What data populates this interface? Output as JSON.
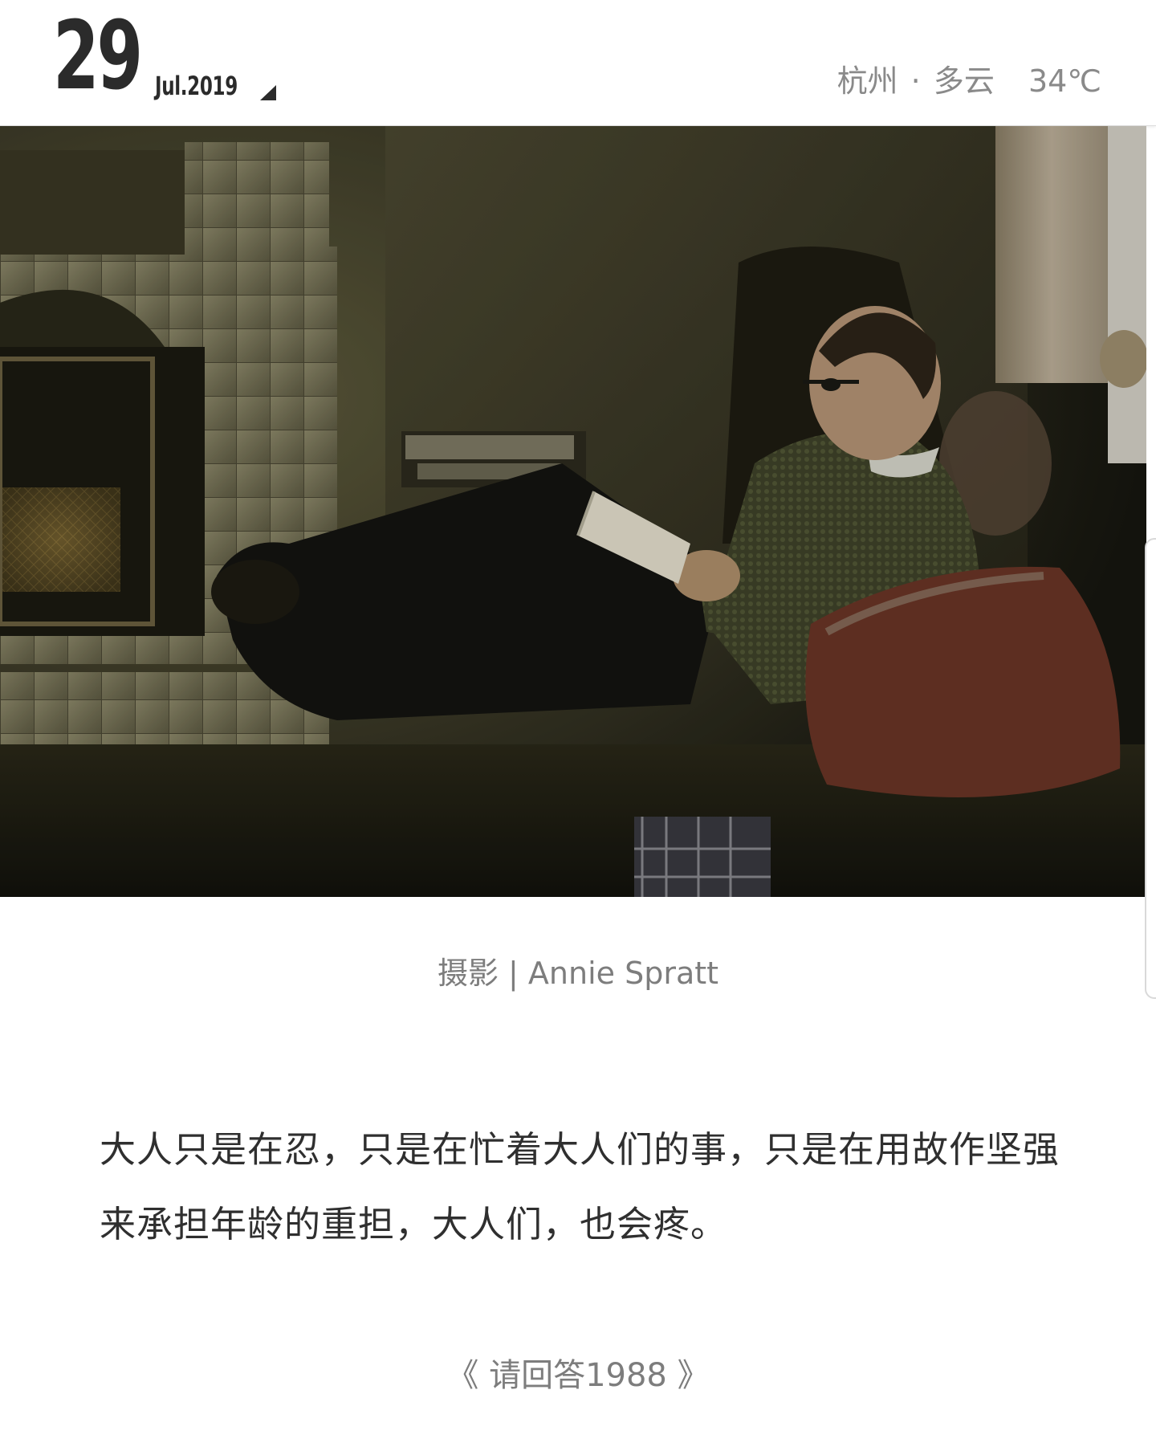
{
  "header": {
    "day": "29",
    "month_year": "Jul.2019",
    "city": "杭州",
    "separator": "·",
    "condition": "多云",
    "temperature": "34℃"
  },
  "photo": {
    "description_icon": "photo-image",
    "credit": "摄影 | Annie Spratt"
  },
  "quote": {
    "text": "大人只是在忍，只是在忙着大人们的事，只是在用故作坚强来承担年龄的重担，大人们，也会疼。",
    "source": "《 请回答1988 》"
  },
  "colors": {
    "text_dark": "#2b2b2b",
    "text_muted": "#7d7d7d",
    "background": "#ffffff"
  }
}
